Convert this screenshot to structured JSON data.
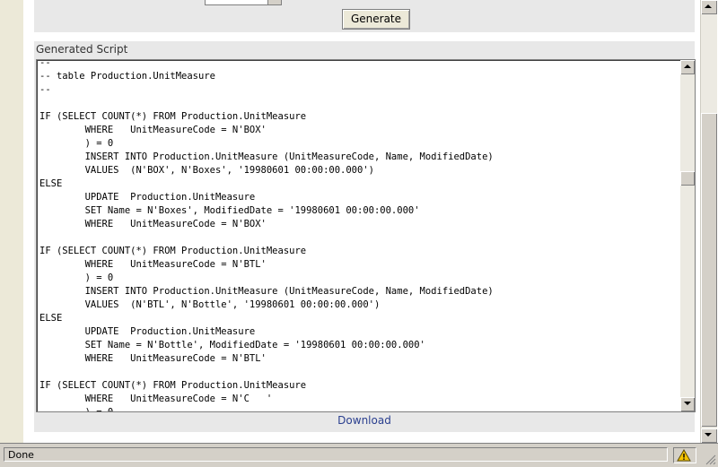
{
  "toolbar": {
    "generate_label": "Generate"
  },
  "section": {
    "label": "Generated Script"
  },
  "script": {
    "text": "--\n-- table Production.UnitMeasure\n--\n\nIF (SELECT COUNT(*) FROM Production.UnitMeasure\n        WHERE   UnitMeasureCode = N'BOX'\n        ) = 0\n        INSERT INTO Production.UnitMeasure (UnitMeasureCode, Name, ModifiedDate)\n        VALUES  (N'BOX', N'Boxes', '19980601 00:00:00.000')\nELSE\n        UPDATE  Production.UnitMeasure\n        SET Name = N'Boxes', ModifiedDate = '19980601 00:00:00.000'\n        WHERE   UnitMeasureCode = N'BOX'\n\nIF (SELECT COUNT(*) FROM Production.UnitMeasure\n        WHERE   UnitMeasureCode = N'BTL'\n        ) = 0\n        INSERT INTO Production.UnitMeasure (UnitMeasureCode, Name, ModifiedDate)\n        VALUES  (N'BTL', N'Bottle', '19980601 00:00:00.000')\nELSE\n        UPDATE  Production.UnitMeasure\n        SET Name = N'Bottle', ModifiedDate = '19980601 00:00:00.000'\n        WHERE   UnitMeasureCode = N'BTL'\n\nIF (SELECT COUNT(*) FROM Production.UnitMeasure\n        WHERE   UnitMeasureCode = N'C   '\n        ) = 0"
  },
  "download": {
    "label": "Download"
  },
  "status_bar": {
    "text": "Done",
    "icon": "warning-icon"
  },
  "colors": {
    "panel": "#e8e8e8",
    "link": "#2a3f8f",
    "chrome": "#d4d0c8"
  }
}
